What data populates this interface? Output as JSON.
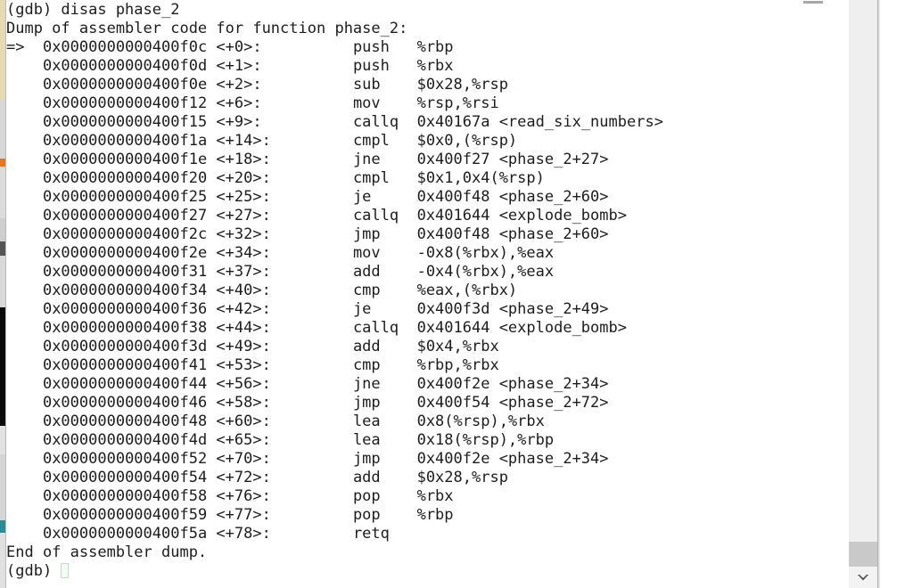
{
  "terminal": {
    "prompt": "(gdb)",
    "command_line": "(gdb) disas phase_2",
    "dump_header": "Dump of assembler code for function phase_2:",
    "end_line": "End of assembler dump.",
    "final_prompt": "(gdb) ",
    "current_instruction_marker": "=>",
    "function_name": "phase_2",
    "lines": [
      {
        "marker": "=> ",
        "text": "   0x0000000000400f0c <+0>:\t\tpush   %rbp"
      },
      {
        "marker": "   ",
        "text": "   0x0000000000400f0d <+1>:\t\tpush   %rbx"
      },
      {
        "marker": "   ",
        "text": "   0x0000000000400f0e <+2>:\t\tsub    $0x28,%rsp"
      },
      {
        "marker": "   ",
        "text": "   0x0000000000400f12 <+6>:\t\tmov    %rsp,%rsi"
      },
      {
        "marker": "   ",
        "text": "   0x0000000000400f15 <+9>:\t\tcallq  0x40167a <read_six_numbers>"
      },
      {
        "marker": "   ",
        "text": "   0x0000000000400f1a <+14>:\t\tcmpl   $0x0,(%rsp)"
      },
      {
        "marker": "   ",
        "text": "   0x0000000000400f1e <+18>:\t\tjne    0x400f27 <phase_2+27>"
      },
      {
        "marker": "   ",
        "text": "   0x0000000000400f20 <+20>:\t\tcmpl   $0x1,0x4(%rsp)"
      },
      {
        "marker": "   ",
        "text": "   0x0000000000400f25 <+25>:\t\tje     0x400f48 <phase_2+60>"
      },
      {
        "marker": "   ",
        "text": "   0x0000000000400f27 <+27>:\t\tcallq  0x401644 <explode_bomb>"
      },
      {
        "marker": "   ",
        "text": "   0x0000000000400f2c <+32>:\t\tjmp    0x400f48 <phase_2+60>"
      },
      {
        "marker": "   ",
        "text": "   0x0000000000400f2e <+34>:\t\tmov    -0x8(%rbx),%eax"
      },
      {
        "marker": "   ",
        "text": "   0x0000000000400f31 <+37>:\t\tadd    -0x4(%rbx),%eax"
      },
      {
        "marker": "   ",
        "text": "   0x0000000000400f34 <+40>:\t\tcmp    %eax,(%rbx)"
      },
      {
        "marker": "   ",
        "text": "   0x0000000000400f36 <+42>:\t\tje     0x400f3d <phase_2+49>"
      },
      {
        "marker": "   ",
        "text": "   0x0000000000400f38 <+44>:\t\tcallq  0x401644 <explode_bomb>"
      },
      {
        "marker": "   ",
        "text": "   0x0000000000400f3d <+49>:\t\tadd    $0x4,%rbx"
      },
      {
        "marker": "   ",
        "text": "   0x0000000000400f41 <+53>:\t\tcmp    %rbp,%rbx"
      },
      {
        "marker": "   ",
        "text": "   0x0000000000400f44 <+56>:\t\tjne    0x400f2e <phase_2+34>"
      },
      {
        "marker": "   ",
        "text": "   0x0000000000400f46 <+58>:\t\tjmp    0x400f54 <phase_2+72>"
      },
      {
        "marker": "   ",
        "text": "   0x0000000000400f48 <+60>:\t\tlea    0x8(%rsp),%rbx"
      },
      {
        "marker": "   ",
        "text": "   0x0000000000400f4d <+65>:\t\tlea    0x18(%rsp),%rbp"
      },
      {
        "marker": "   ",
        "text": "   0x0000000000400f52 <+70>:\t\tjmp    0x400f2e <phase_2+34>"
      },
      {
        "marker": "   ",
        "text": "   0x0000000000400f54 <+72>:\t\tadd    $0x28,%rsp"
      },
      {
        "marker": "   ",
        "text": "   0x0000000000400f58 <+76>:\t\tpop    %rbx"
      },
      {
        "marker": "   ",
        "text": "   0x0000000000400f59 <+77>:\t\tpop    %rbp"
      },
      {
        "marker": "   ",
        "text": "   0x0000000000400f5a <+78>:\t\tretq   "
      }
    ],
    "instructions": [
      {
        "address": "0x0000000000400f0c",
        "offset": "<+0>:",
        "mnemonic": "push",
        "operands": "%rbp",
        "current": true
      },
      {
        "address": "0x0000000000400f0d",
        "offset": "<+1>:",
        "mnemonic": "push",
        "operands": "%rbx",
        "current": false
      },
      {
        "address": "0x0000000000400f0e",
        "offset": "<+2>:",
        "mnemonic": "sub",
        "operands": "$0x28,%rsp",
        "current": false
      },
      {
        "address": "0x0000000000400f12",
        "offset": "<+6>:",
        "mnemonic": "mov",
        "operands": "%rsp,%rsi",
        "current": false
      },
      {
        "address": "0x0000000000400f15",
        "offset": "<+9>:",
        "mnemonic": "callq",
        "operands": "0x40167a <read_six_numbers>",
        "current": false
      },
      {
        "address": "0x0000000000400f1a",
        "offset": "<+14>:",
        "mnemonic": "cmpl",
        "operands": "$0x0,(%rsp)",
        "current": false
      },
      {
        "address": "0x0000000000400f1e",
        "offset": "<+18>:",
        "mnemonic": "jne",
        "operands": "0x400f27 <phase_2+27>",
        "current": false
      },
      {
        "address": "0x0000000000400f20",
        "offset": "<+20>:",
        "mnemonic": "cmpl",
        "operands": "$0x1,0x4(%rsp)",
        "current": false
      },
      {
        "address": "0x0000000000400f25",
        "offset": "<+25>:",
        "mnemonic": "je",
        "operands": "0x400f48 <phase_2+60>",
        "current": false
      },
      {
        "address": "0x0000000000400f27",
        "offset": "<+27>:",
        "mnemonic": "callq",
        "operands": "0x401644 <explode_bomb>",
        "current": false
      },
      {
        "address": "0x0000000000400f2c",
        "offset": "<+32>:",
        "mnemonic": "jmp",
        "operands": "0x400f48 <phase_2+60>",
        "current": false
      },
      {
        "address": "0x0000000000400f2e",
        "offset": "<+34>:",
        "mnemonic": "mov",
        "operands": "-0x8(%rbx),%eax",
        "current": false
      },
      {
        "address": "0x0000000000400f31",
        "offset": "<+37>:",
        "mnemonic": "add",
        "operands": "-0x4(%rbx),%eax",
        "current": false
      },
      {
        "address": "0x0000000000400f34",
        "offset": "<+40>:",
        "mnemonic": "cmp",
        "operands": "%eax,(%rbx)",
        "current": false
      },
      {
        "address": "0x0000000000400f36",
        "offset": "<+42>:",
        "mnemonic": "je",
        "operands": "0x400f3d <phase_2+49>",
        "current": false
      },
      {
        "address": "0x0000000000400f38",
        "offset": "<+44>:",
        "mnemonic": "callq",
        "operands": "0x401644 <explode_bomb>",
        "current": false
      },
      {
        "address": "0x0000000000400f3d",
        "offset": "<+49>:",
        "mnemonic": "add",
        "operands": "$0x4,%rbx",
        "current": false
      },
      {
        "address": "0x0000000000400f41",
        "offset": "<+53>:",
        "mnemonic": "cmp",
        "operands": "%rbp,%rbx",
        "current": false
      },
      {
        "address": "0x0000000000400f44",
        "offset": "<+56>:",
        "mnemonic": "jne",
        "operands": "0x400f2e <phase_2+34>",
        "current": false
      },
      {
        "address": "0x0000000000400f46",
        "offset": "<+58>:",
        "mnemonic": "jmp",
        "operands": "0x400f54 <phase_2+72>",
        "current": false
      },
      {
        "address": "0x0000000000400f48",
        "offset": "<+60>:",
        "mnemonic": "lea",
        "operands": "0x8(%rsp),%rbx",
        "current": false
      },
      {
        "address": "0x0000000000400f4d",
        "offset": "<+65>:",
        "mnemonic": "lea",
        "operands": "0x18(%rsp),%rbp",
        "current": false
      },
      {
        "address": "0x0000000000400f52",
        "offset": "<+70>:",
        "mnemonic": "jmp",
        "operands": "0x400f2e <phase_2+34>",
        "current": false
      },
      {
        "address": "0x0000000000400f54",
        "offset": "<+72>:",
        "mnemonic": "add",
        "operands": "$0x28,%rsp",
        "current": false
      },
      {
        "address": "0x0000000000400f58",
        "offset": "<+76>:",
        "mnemonic": "pop",
        "operands": "%rbx",
        "current": false
      },
      {
        "address": "0x0000000000400f59",
        "offset": "<+77>:",
        "mnemonic": "pop",
        "operands": "%rbp",
        "current": false
      },
      {
        "address": "0x0000000000400f5a",
        "offset": "<+78>:",
        "mnemonic": "retq",
        "operands": "",
        "current": false
      }
    ]
  },
  "scrollbar": {
    "down_arrow_icon": "chevron-down-icon",
    "thumb_color": "#c9c9c9",
    "track_color": "#efefef"
  },
  "colors": {
    "text": "#1d1d1d",
    "background": "#ffffff",
    "accent_orange": "#e8751a",
    "accent_teal": "#2e8b96"
  }
}
